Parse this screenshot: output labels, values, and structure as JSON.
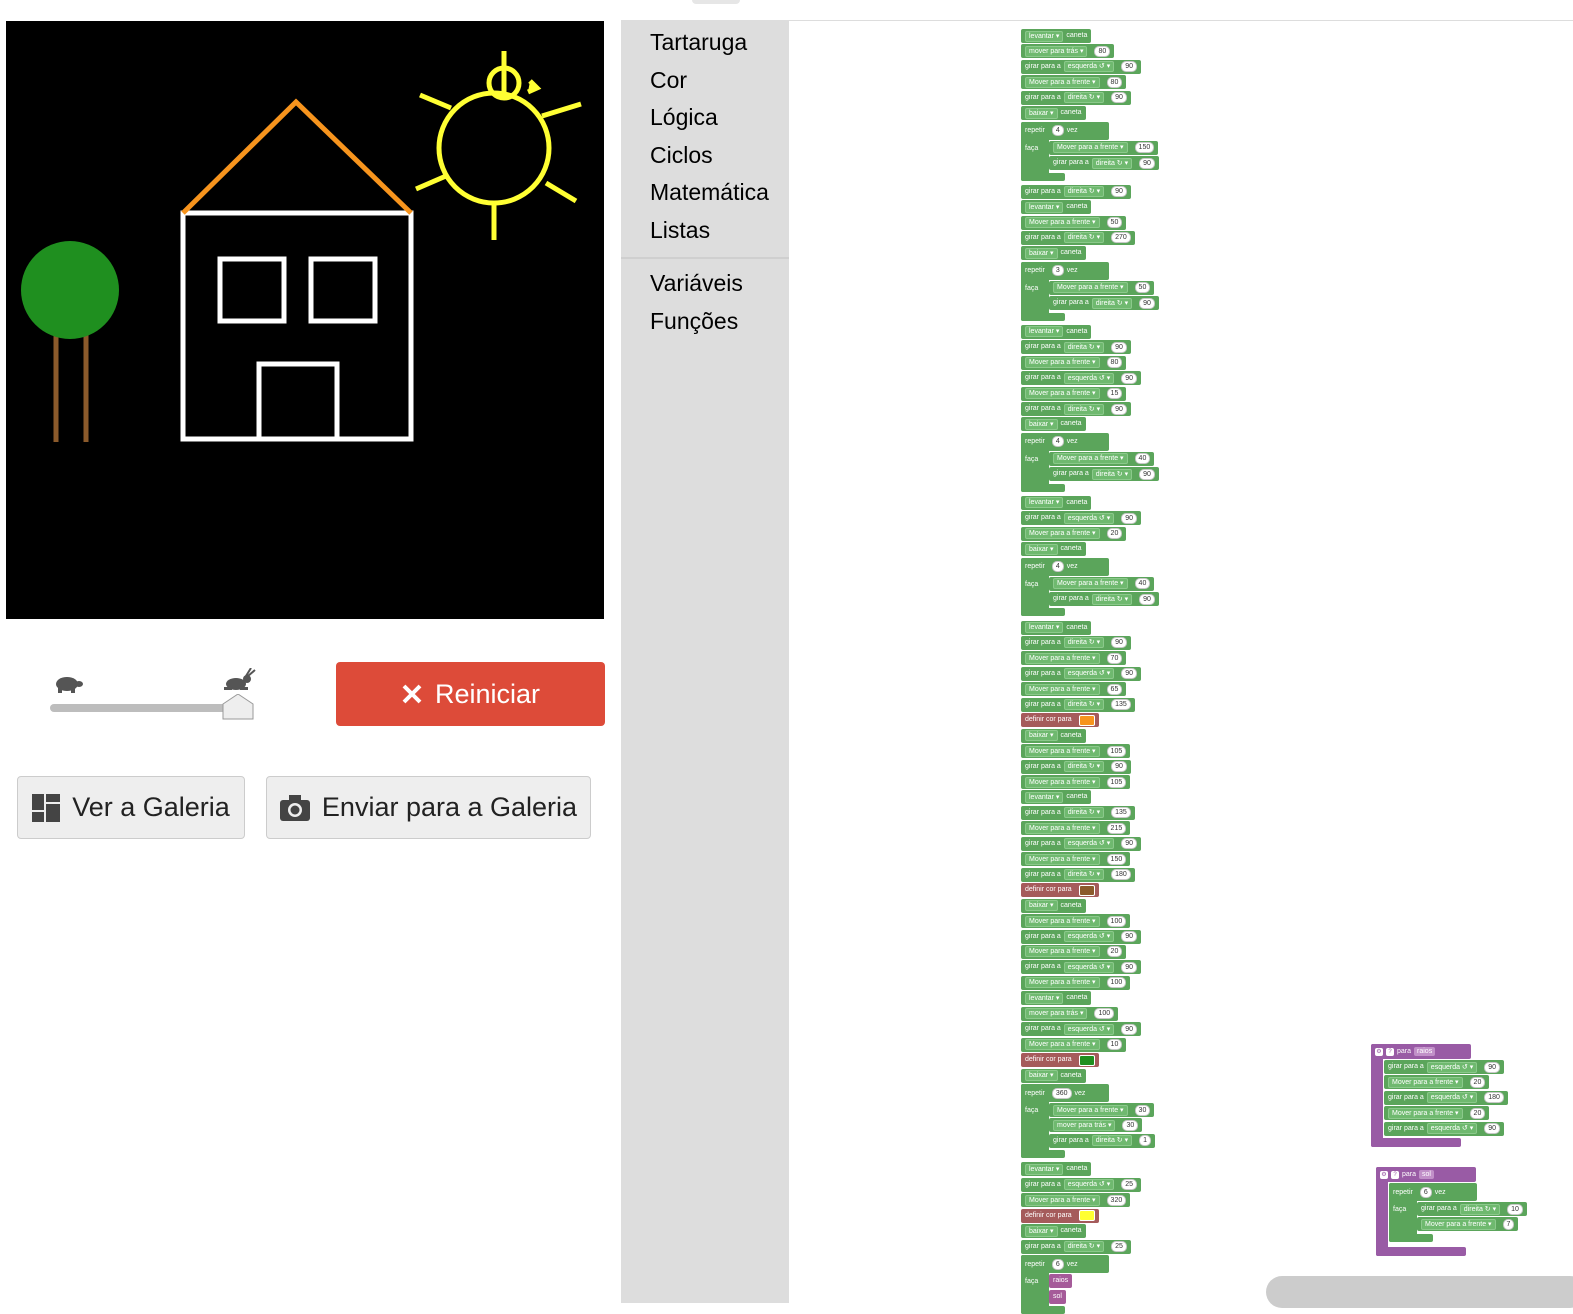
{
  "controls": {
    "reset_label": "Reiniciar",
    "gallery_label": "Ver a Galeria",
    "send_label": "Enviar para a Galeria",
    "speed_level": 1.0
  },
  "toolbox": {
    "categories": [
      "Tartaruga",
      "Cor",
      "Lógica",
      "Ciclos",
      "Matemática",
      "Listas"
    ],
    "extra_categories": [
      "Variáveis",
      "Funções"
    ]
  },
  "colors": {
    "reset": "#dd4b39",
    "block_turtle": "#5ba55b",
    "block_color": "#a55b5b",
    "block_function": "#995ba5",
    "roof": "#f7941d",
    "house": "#ffffff",
    "tree_top": "#1f8f1f",
    "trunk": "#8b5a2b",
    "sun": "#ffff33"
  },
  "program": [
    {
      "t": "pen",
      "a": "levantar"
    },
    {
      "t": "move",
      "a": "mover para trás",
      "n": "80"
    },
    {
      "t": "turn",
      "a": "esquerda ↺",
      "n": "90"
    },
    {
      "t": "move",
      "a": "Mover para a frente",
      "n": "80"
    },
    {
      "t": "turn",
      "a": "direita ↻",
      "n": "90"
    },
    {
      "t": "pen",
      "a": "baixar"
    },
    {
      "t": "repeat",
      "n": "4",
      "body": [
        {
          "t": "move",
          "a": "Mover para a frente",
          "n": "150"
        },
        {
          "t": "turn",
          "a": "direita ↻",
          "n": "90"
        }
      ]
    },
    {
      "t": "turn",
      "a": "direita ↻",
      "n": "90"
    },
    {
      "t": "pen",
      "a": "levantar"
    },
    {
      "t": "move",
      "a": "Mover para a frente",
      "n": "50"
    },
    {
      "t": "turn",
      "a": "direita ↻",
      "n": "270"
    },
    {
      "t": "pen",
      "a": "baixar"
    },
    {
      "t": "repeat",
      "n": "3",
      "body": [
        {
          "t": "move",
          "a": "Mover para a frente",
          "n": "50"
        },
        {
          "t": "turn",
          "a": "direita ↻",
          "n": "90"
        }
      ]
    },
    {
      "t": "pen",
      "a": "levantar"
    },
    {
      "t": "turn",
      "a": "direita ↻",
      "n": "90"
    },
    {
      "t": "move",
      "a": "Mover para a frente",
      "n": "80"
    },
    {
      "t": "turn",
      "a": "esquerda ↺",
      "n": "90"
    },
    {
      "t": "move",
      "a": "Mover para a frente",
      "n": "15"
    },
    {
      "t": "turn",
      "a": "direita ↻",
      "n": "90"
    },
    {
      "t": "pen",
      "a": "baixar"
    },
    {
      "t": "repeat",
      "n": "4",
      "body": [
        {
          "t": "move",
          "a": "Mover para a frente",
          "n": "40"
        },
        {
          "t": "turn",
          "a": "direita ↻",
          "n": "90"
        }
      ]
    },
    {
      "t": "pen",
      "a": "levantar"
    },
    {
      "t": "turn",
      "a": "esquerda ↺",
      "n": "90"
    },
    {
      "t": "move",
      "a": "Mover para a frente",
      "n": "20"
    },
    {
      "t": "pen",
      "a": "baixar"
    },
    {
      "t": "repeat",
      "n": "4",
      "body": [
        {
          "t": "move",
          "a": "Mover para a frente",
          "n": "40"
        },
        {
          "t": "turn",
          "a": "direita ↻",
          "n": "90"
        }
      ]
    },
    {
      "t": "pen",
      "a": "levantar"
    },
    {
      "t": "turn",
      "a": "direita ↻",
      "n": "90"
    },
    {
      "t": "move",
      "a": "Mover para a frente",
      "n": "70"
    },
    {
      "t": "turn",
      "a": "esquerda ↺",
      "n": "90"
    },
    {
      "t": "move",
      "a": "Mover para a frente",
      "n": "65"
    },
    {
      "t": "turn",
      "a": "direita ↻",
      "n": "135"
    },
    {
      "t": "color",
      "c": "#f7941d"
    },
    {
      "t": "pen",
      "a": "baixar"
    },
    {
      "t": "move",
      "a": "Mover para a frente",
      "n": "105"
    },
    {
      "t": "turn",
      "a": "direita ↻",
      "n": "90"
    },
    {
      "t": "move",
      "a": "Mover para a frente",
      "n": "105"
    },
    {
      "t": "pen",
      "a": "levantar"
    },
    {
      "t": "turn",
      "a": "direita ↻",
      "n": "135"
    },
    {
      "t": "move",
      "a": "Mover para a frente",
      "n": "215"
    },
    {
      "t": "turn",
      "a": "esquerda ↺",
      "n": "90"
    },
    {
      "t": "move",
      "a": "Mover para a frente",
      "n": "150"
    },
    {
      "t": "turn",
      "a": "direita ↻",
      "n": "180"
    },
    {
      "t": "color",
      "c": "#8b5a2b"
    },
    {
      "t": "pen",
      "a": "baixar"
    },
    {
      "t": "move",
      "a": "Mover para a frente",
      "n": "100"
    },
    {
      "t": "turn",
      "a": "esquerda ↺",
      "n": "90"
    },
    {
      "t": "move",
      "a": "Mover para a frente",
      "n": "20"
    },
    {
      "t": "turn",
      "a": "esquerda ↺",
      "n": "90"
    },
    {
      "t": "move",
      "a": "Mover para a frente",
      "n": "100"
    },
    {
      "t": "pen",
      "a": "levantar"
    },
    {
      "t": "move",
      "a": "mover para trás",
      "n": "100"
    },
    {
      "t": "turn",
      "a": "esquerda ↺",
      "n": "90"
    },
    {
      "t": "move",
      "a": "Mover para a frente",
      "n": "10"
    },
    {
      "t": "color",
      "c": "#1f8f1f"
    },
    {
      "t": "pen",
      "a": "baixar"
    },
    {
      "t": "repeat",
      "n": "360",
      "body": [
        {
          "t": "move",
          "a": "Mover para a frente",
          "n": "30"
        },
        {
          "t": "move",
          "a": "mover para trás",
          "n": "30"
        },
        {
          "t": "turn",
          "a": "direita ↻",
          "n": "1"
        }
      ]
    },
    {
      "t": "pen",
      "a": "levantar"
    },
    {
      "t": "turn",
      "a": "esquerda ↺",
      "n": "25"
    },
    {
      "t": "move",
      "a": "Mover para a frente",
      "n": "320"
    },
    {
      "t": "color",
      "c": "#ffff33"
    },
    {
      "t": "pen",
      "a": "baixar"
    },
    {
      "t": "turn",
      "a": "direita ↻",
      "n": "25"
    },
    {
      "t": "repeat",
      "n": "6",
      "body": [
        {
          "t": "call",
          "name": "raios"
        },
        {
          "t": "call",
          "name": "sol"
        }
      ]
    }
  ],
  "functions": [
    {
      "name": "raios",
      "body": [
        {
          "t": "turn",
          "a": "esquerda ↺",
          "n": "90"
        },
        {
          "t": "move",
          "a": "Mover para a frente",
          "n": "20"
        },
        {
          "t": "turn",
          "a": "esquerda ↺",
          "n": "180"
        },
        {
          "t": "move",
          "a": "Mover para a frente",
          "n": "20"
        },
        {
          "t": "turn",
          "a": "esquerda ↺",
          "n": "90"
        }
      ]
    },
    {
      "name": "sol",
      "body": [
        {
          "t": "repeat",
          "n": "6",
          "body": [
            {
              "t": "turn",
              "a": "direita ↻",
              "n": "10"
            },
            {
              "t": "move",
              "a": "Mover para a frente",
              "n": "7"
            }
          ]
        }
      ]
    }
  ],
  "labels": {
    "pen_word": "caneta",
    "turn_prefix": "girar para a",
    "repeat": "repetir",
    "times": "vez",
    "do": "faça",
    "set_color": "definir cor para",
    "fn_prefix": "para"
  }
}
